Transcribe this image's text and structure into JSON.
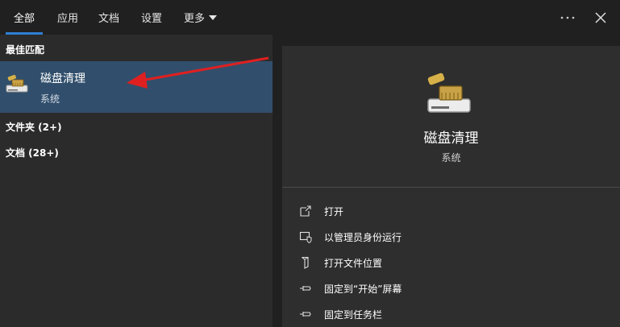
{
  "tabs": [
    {
      "label": "全部",
      "active": true
    },
    {
      "label": "应用",
      "active": false
    },
    {
      "label": "文档",
      "active": false
    },
    {
      "label": "设置",
      "active": false
    },
    {
      "label": "更多",
      "active": false
    }
  ],
  "left": {
    "best_match_header": "最佳匹配",
    "best_match": {
      "name": "磁盘清理",
      "type": "系统"
    },
    "groups": [
      {
        "label": "文件夹 (2+)"
      },
      {
        "label": "文档 (28+)"
      }
    ]
  },
  "right": {
    "title": "磁盘清理",
    "subtitle": "系统",
    "actions": [
      {
        "label": "打开",
        "icon": "open-icon"
      },
      {
        "label": "以管理员身份运行",
        "icon": "shield-icon"
      },
      {
        "label": "打开文件位置",
        "icon": "file-location-icon"
      },
      {
        "label": "固定到“开始”屏幕",
        "icon": "pin-icon"
      },
      {
        "label": "固定到任务栏",
        "icon": "pin-icon"
      }
    ]
  },
  "colors": {
    "accent": "#2d7fd2",
    "selected_item": "#314f6c",
    "annotation_arrow": "#e02020"
  }
}
